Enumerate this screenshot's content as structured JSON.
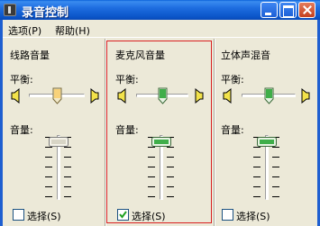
{
  "window": {
    "title": "录音控制"
  },
  "menu": {
    "options": "选项(P)",
    "help": "帮助(H)"
  },
  "columns": [
    {
      "title": "线路音量",
      "balance_label": "平衡:",
      "volume_label": "音量:",
      "select_label": "选择(S)",
      "checked": false,
      "balance": 0.6,
      "volume": 0.85
    },
    {
      "title": "麦克风音量",
      "balance_label": "平衡:",
      "volume_label": "音量:",
      "select_label": "选择(S)",
      "checked": true,
      "balance": 0.6,
      "volume": 0.85
    },
    {
      "title": "立体声混音",
      "balance_label": "平衡:",
      "volume_label": "音量:",
      "select_label": "选择(S)",
      "checked": false,
      "balance": 0.6,
      "volume": 0.85
    }
  ],
  "colors": {
    "titlebar": "#1e6de0",
    "highlight_box": "#d92020",
    "thumb_green": "#3fae49"
  }
}
